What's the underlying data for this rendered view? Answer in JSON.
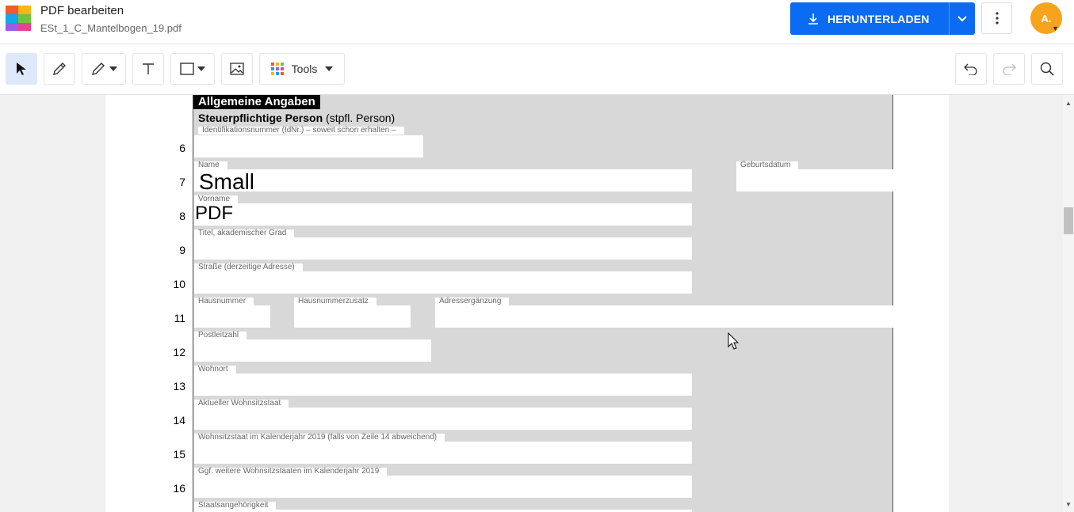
{
  "app": {
    "title": "PDF bearbeiten",
    "file_name": "ESt_1_C_Mantelbogen_19.pdf"
  },
  "header": {
    "download_label": "HERUNTERLADEN",
    "avatar_initials": "A."
  },
  "toolbar": {
    "tools_label": "Tools"
  },
  "form": {
    "section_title": "Allgemeine Angaben",
    "subsection_bold": "Steuerpflichtige Person",
    "subsection_rest": " (stpfl. Person)",
    "rows": [
      {
        "num": "6",
        "labels": [
          "Identifikationsnummer (IdNr.) – soweit schon erhalten –"
        ]
      },
      {
        "num": "7",
        "labels": [
          "Name",
          "Geburtsdatum"
        ],
        "value": "Small"
      },
      {
        "num": "8",
        "labels": [
          "Vorname"
        ],
        "value": "PDF"
      },
      {
        "num": "9",
        "labels": [
          "Titel, akademischer Grad"
        ]
      },
      {
        "num": "10",
        "labels": [
          "Straße (derzeitige Adresse)"
        ]
      },
      {
        "num": "11",
        "labels": [
          "Hausnummer",
          "Hausnummerzusatz",
          "Adressergänzung"
        ]
      },
      {
        "num": "12",
        "labels": [
          "Postleitzahl"
        ]
      },
      {
        "num": "13",
        "labels": [
          "Wohnort"
        ]
      },
      {
        "num": "14",
        "labels": [
          "Aktueller Wohnsitzstaat"
        ]
      },
      {
        "num": "15",
        "labels": [
          "Wohnsitzstaat im Kalenderjahr 2019 (falls von Zeile 14 abweichend)"
        ]
      },
      {
        "num": "16",
        "labels": [
          "Ggf. weitere Wohnsitzstaaten im Kalenderjahr 2019"
        ]
      },
      {
        "num": "",
        "labels": [
          "Staatsangehörigkeit"
        ]
      }
    ]
  },
  "colors": {
    "primary": "#0b6bf3",
    "avatar": "#f7a31c",
    "active_tool": "#dde9fb"
  },
  "icons": [
    "select-arrow-icon",
    "pencil-icon",
    "highlighter-icon",
    "text-icon",
    "rectangle-icon",
    "image-icon",
    "tools-grid-icon",
    "undo-icon",
    "redo-icon",
    "search-icon",
    "download-icon",
    "chevron-down-icon",
    "more-vertical-icon"
  ]
}
